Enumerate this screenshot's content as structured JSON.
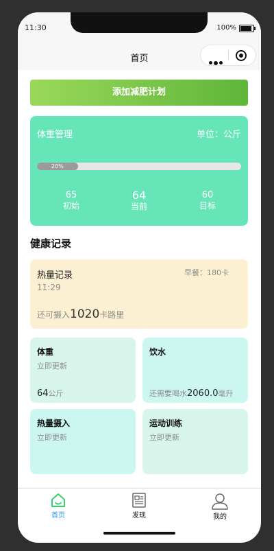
{
  "status": {
    "time": "11:30",
    "battery": "100%"
  },
  "nav": {
    "title": "首页"
  },
  "add_plan_button": "添加减肥计划",
  "weight": {
    "title": "体重管理",
    "unit": "单位：公斤",
    "progress_label": "20%",
    "progress": 0.2,
    "stats": [
      {
        "value": "65",
        "label": "初始"
      },
      {
        "value": "64",
        "label": "当前"
      },
      {
        "value": "60",
        "label": "目标"
      }
    ]
  },
  "health": {
    "section_title": "健康记录",
    "calorie": {
      "title": "热量记录",
      "meal": "早餐：180卡",
      "time": "11:29",
      "remain_prefix": "还可摄入",
      "remain_value": "1020",
      "remain_suffix": "卡路里"
    },
    "tiles": [
      {
        "title": "体重",
        "sub": "立即更新",
        "value": "64",
        "unit": "公斤"
      },
      {
        "title": "饮水",
        "prefix": "还需要喝水",
        "value": "2060.0",
        "unit": "毫升"
      },
      {
        "title": "热量摄入",
        "sub": "立即更新"
      },
      {
        "title": "运动训练",
        "sub": "立即更新"
      }
    ]
  },
  "tabbar": [
    {
      "label": "首页",
      "icon": "home-icon",
      "active": true
    },
    {
      "label": "发现",
      "icon": "discover-icon"
    },
    {
      "label": "我的",
      "icon": "user-icon"
    }
  ],
  "colors": {
    "accent": "#2e9be8",
    "weight_card": "#66e6b8",
    "calorie_card": "#fbf0d2"
  }
}
